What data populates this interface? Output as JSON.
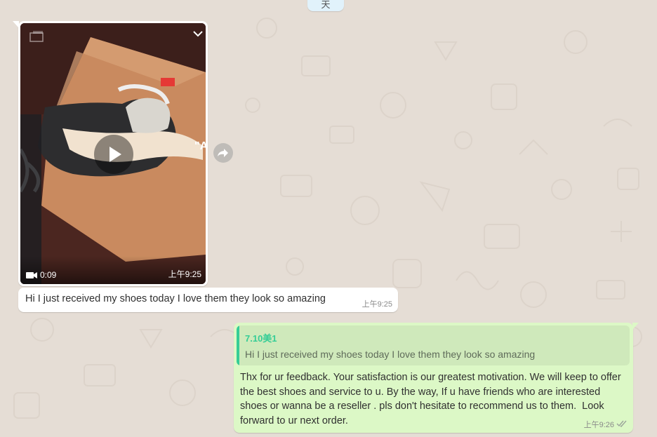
{
  "date_chip": {
    "label": "天"
  },
  "incoming_video": {
    "duration": "0:09",
    "time": "上午9:25",
    "icons": {
      "video": "video-camera-icon",
      "play": "play-icon",
      "expand": "chevron-down-icon",
      "forward": "forward-icon"
    }
  },
  "incoming_text": {
    "text": "Hi I just received my shoes today I love them they look so amazing",
    "time": "上午9:25"
  },
  "outgoing_reply": {
    "quoted_author": "7.10美1",
    "quoted_text": "Hi I just received my shoes today I love them they look so amazing",
    "text": "Thx for ur feedback. Your satisfaction is our greatest motivation. We will keep to offer the best shoes and service to u. By the way, If u have friends who are interested shoes or wanna be a reseller . pls don't hesitate to recommend us to them.  Look forward to ur next order.",
    "time": "上午9:26",
    "status_icon": "double-check-icon"
  },
  "colors": {
    "chat_background": "#e5ddd5",
    "incoming_bubble": "#ffffff",
    "outgoing_bubble": "#dcf8c6",
    "quote_accent": "#35cd96"
  }
}
